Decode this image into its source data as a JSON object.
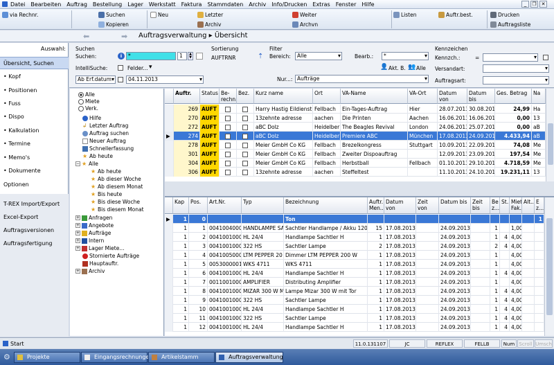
{
  "menu": [
    "Datei",
    "Bearbeiten",
    "Auftrag",
    "Bestellung",
    "Lager",
    "Werkstatt",
    "Faktura",
    "Stammdaten",
    "Archiv",
    "Info/Drucken",
    "Extras",
    "Fenster",
    "Hilfe"
  ],
  "toolbar": {
    "via_rechnr": "via Rechnr.",
    "suchen": "Suchen",
    "kopieren": "Kopieren",
    "neu": "Neu",
    "letzter": "Letzter",
    "archiv": "Archiv",
    "weiter": "Weiter",
    "archvn": "Archvn",
    "listen": "Listen",
    "auftr_best": "Auftr.best.",
    "drucken": "Drucken",
    "auftragsliste": "Auftragsliste"
  },
  "title": "Auftragsverwaltung ▸ Übersicht",
  "sidebar": {
    "header": "Auswahl:",
    "items": [
      "Übersicht, Suchen",
      "• Kopf",
      "• Positionen",
      "• Fuss",
      "• Dispo",
      "• Kalkulation",
      "• Termine",
      "• Memo's",
      "• Dokumente",
      "Optionen"
    ],
    "extra": [
      "T-REX Import/Export",
      "Excel-Export",
      "Auftragsversionen",
      "Auftragsfertigung"
    ]
  },
  "filter": {
    "suchen_title": "Suchen",
    "suchen_label": "Suchen:",
    "suchen_value": "*",
    "suchen_count": "1",
    "intellisuche_label": "IntelliSuche:",
    "felder": "Felder...",
    "ab_erf_datum": "Ab Erf.datum",
    "date_value": "04.11.2013",
    "sortierung_label": "Sortierung",
    "sortierung_value": "AUFTRNR",
    "filter_label": "Filter",
    "bereich_label": "Bereich:",
    "bereich_value": "Alle",
    "bearb_label": "Bearb.:",
    "bearb_value": "*",
    "akt_b": "Akt. B.",
    "alle": "Alle",
    "nur_label": "Nur...:",
    "nur_value": "Aufträge",
    "kennzeichen_title": "Kennzeichen",
    "kennzch_label": "Kennzch.:",
    "kennzch_op": "=",
    "versandart_label": "Versandart:",
    "auftragsart_label": "Auftragsart:"
  },
  "tree": {
    "radios": [
      "Alle",
      "Miete",
      "Verk."
    ],
    "items": [
      "Hilfe",
      "Letzter Auftrag",
      "Auftrag suchen",
      "Neuer Auftrag",
      "Schnellerfassung",
      "Ab heute",
      "Alle",
      "Ab heute",
      "Ab dieser Woche",
      "Ab diesem Monat",
      "Bis heute",
      "Bis diese Woche",
      "Bis diesem Monat",
      "Anfragen",
      "Angebote",
      "Aufträge",
      "Intern",
      "Lager Miete...",
      "Stornierte Aufträge",
      "Hauptauftr.",
      "Archiv"
    ]
  },
  "grid1": {
    "headers": [
      "Auftr.",
      "Status",
      "Be-rechn.",
      "Bez.",
      "Kurz name",
      "Ort",
      "VA-Name",
      "VA-Ort",
      "Datum von",
      "Datum bis",
      "Ges. Betrag",
      "Na"
    ],
    "rows": [
      [
        "269",
        "AUFT",
        "",
        "",
        "Harry Hastig Eildienst",
        "Fellbach",
        "Ein-Tages-Auftrag",
        "Hier",
        "28.07.2013",
        "30.08.2013",
        "24,99",
        "Ha"
      ],
      [
        "270",
        "AUFT",
        "",
        "",
        "13zehnte adresse",
        "aachen",
        "Die Printen",
        "Aachen",
        "16.06.2013",
        "16.06.2013",
        "0,00",
        "13"
      ],
      [
        "272",
        "AUFT",
        "",
        "",
        "aBC Dolz",
        "Heidelber",
        "The Beagles Revival",
        "London",
        "24.06.2013",
        "25.07.2013",
        "0,00",
        "aB"
      ],
      [
        "274",
        "AUFT",
        "",
        "",
        "aBC Dolz",
        "Heidelber",
        "Premiere ABC",
        "München",
        "17.08.2013",
        "24.09.2013",
        "4.433,94",
        "aB"
      ],
      [
        "278",
        "AUFT",
        "",
        "",
        "Meier GmbH   Co KG",
        "Fellbach",
        "Brezelkongress",
        "Stuttgart",
        "10.09.2013",
        "22.09.2013",
        "74,08",
        "Me"
      ],
      [
        "301",
        "AUFT",
        "",
        "",
        "Meier GmbH   Co KG",
        "Fellbach",
        "Zweiter Dispoauftrag",
        "",
        "12.09.2013",
        "23.09.2013",
        "197,54",
        "Me"
      ],
      [
        "304",
        "AUFT",
        "",
        "",
        "Meier GmbH   Co KG",
        "Fellbach",
        "Herbstball",
        "Fellbach",
        "01.10.2013",
        "29.10.2014",
        "4.718,59",
        "Me"
      ],
      [
        "306",
        "AUFT",
        "",
        "",
        "13zehnte adresse",
        "aachen",
        "Steffeltest",
        "",
        "11.10.2013",
        "24.10.2013",
        "19.231,11",
        "13"
      ]
    ]
  },
  "grid2": {
    "headers": [
      "Kap",
      "Pos.",
      "Art.Nr.",
      "Typ",
      "Bezeichnung",
      "Auftr. Men...",
      "Datum von",
      "Zeit von",
      "Datum bis",
      "Zeit bis",
      "Be z...",
      "St...",
      "Miet Fak...",
      "Alt...",
      "E z..."
    ],
    "first_row": [
      "1",
      "0",
      "",
      "",
      "Ton",
      "",
      "",
      "",
      "",
      "",
      "",
      "",
      "",
      "",
      "1"
    ],
    "rows": [
      [
        "1",
        "1",
        "0041004000",
        "HANDLAMPE SA",
        "Sachtler Handlampe / Akku 120",
        "15",
        "17.08.2013",
        "",
        "24.09.2013",
        "",
        "1",
        "",
        "1,00",
        "",
        ""
      ],
      [
        "1",
        "2",
        "0041001000",
        "HL 24/4",
        "Handlampe Sachtler H",
        "1",
        "17.08.2013",
        "",
        "24.09.2013",
        "",
        "1",
        "4",
        "4,00",
        "",
        ""
      ],
      [
        "1",
        "3",
        "0041001000",
        "322 HS",
        "Sachtler Lampe",
        "2",
        "17.08.2013",
        "",
        "24.09.2013",
        "",
        "2",
        "4",
        "4,00",
        "",
        ""
      ],
      [
        "1",
        "4",
        "0041005000",
        "LTM PEPPER 20",
        "Dimmer LTM PEPPER 200 W",
        "1",
        "17.08.2013",
        "",
        "24.09.2013",
        "",
        "1",
        "",
        "4,00",
        "",
        ""
      ],
      [
        "1",
        "5",
        "0053000001",
        "WKS 4711",
        "WKS 4711",
        "1",
        "17.08.2013",
        "",
        "24.09.2013",
        "",
        "1",
        "",
        "4,00",
        "",
        ""
      ],
      [
        "1",
        "6",
        "0041001000",
        "HL 24/4",
        "Handlampe Sachtler H",
        "1",
        "17.08.2013",
        "",
        "24.09.2013",
        "",
        "1",
        "4",
        "4,00",
        "",
        ""
      ],
      [
        "1",
        "7",
        "0011001000",
        "AMPLIFIER",
        "Distributing Amplifier",
        "1",
        "17.08.2013",
        "",
        "24.09.2013",
        "",
        "1",
        "",
        "4,00",
        "",
        ""
      ],
      [
        "1",
        "8",
        "0041001000",
        "MIZAR 300 W M",
        "Lampe Mizar 300 W mit Tor",
        "1",
        "17.08.2013",
        "",
        "24.09.2013",
        "",
        "1",
        "4",
        "4,00",
        "",
        ""
      ],
      [
        "1",
        "9",
        "0041001000",
        "322 HS",
        "Sachtler Lampe",
        "1",
        "17.08.2013",
        "",
        "24.09.2013",
        "",
        "1",
        "4",
        "4,00",
        "",
        ""
      ],
      [
        "1",
        "10",
        "0041001000",
        "HL 24/4",
        "Handlampe Sachtler H",
        "1",
        "17.08.2013",
        "",
        "24.09.2013",
        "",
        "1",
        "4",
        "4,00",
        "",
        ""
      ],
      [
        "1",
        "11",
        "0041001000",
        "322 HS",
        "Sachtler Lampe",
        "1",
        "17.08.2013",
        "",
        "24.09.2013",
        "",
        "1",
        "4",
        "4,00",
        "",
        ""
      ],
      [
        "1",
        "12",
        "0041001000",
        "HL 24/4",
        "Handlampe Sachtler H",
        "1",
        "17.08.2013",
        "",
        "24.09.2013",
        "",
        "1",
        "4",
        "4,00",
        "",
        ""
      ]
    ]
  },
  "status": {
    "start": "Start",
    "version": "11.0.131107",
    "user": "JC",
    "db": "REFLEX",
    "site": "FELLB",
    "num": "Num",
    "scroll": "Scroll",
    "umsch": "Umsch"
  },
  "taskbar": [
    "Projekte",
    "Eingangsrechnungen",
    "Artikelstamm",
    "Auftragsverwaltung"
  ],
  "colors": {
    "accent": "#3070d8",
    "selected": "#3a78d6",
    "auft": "#ffd700",
    "search_field": "#40e0e8",
    "first_row": "#3a78d6"
  }
}
